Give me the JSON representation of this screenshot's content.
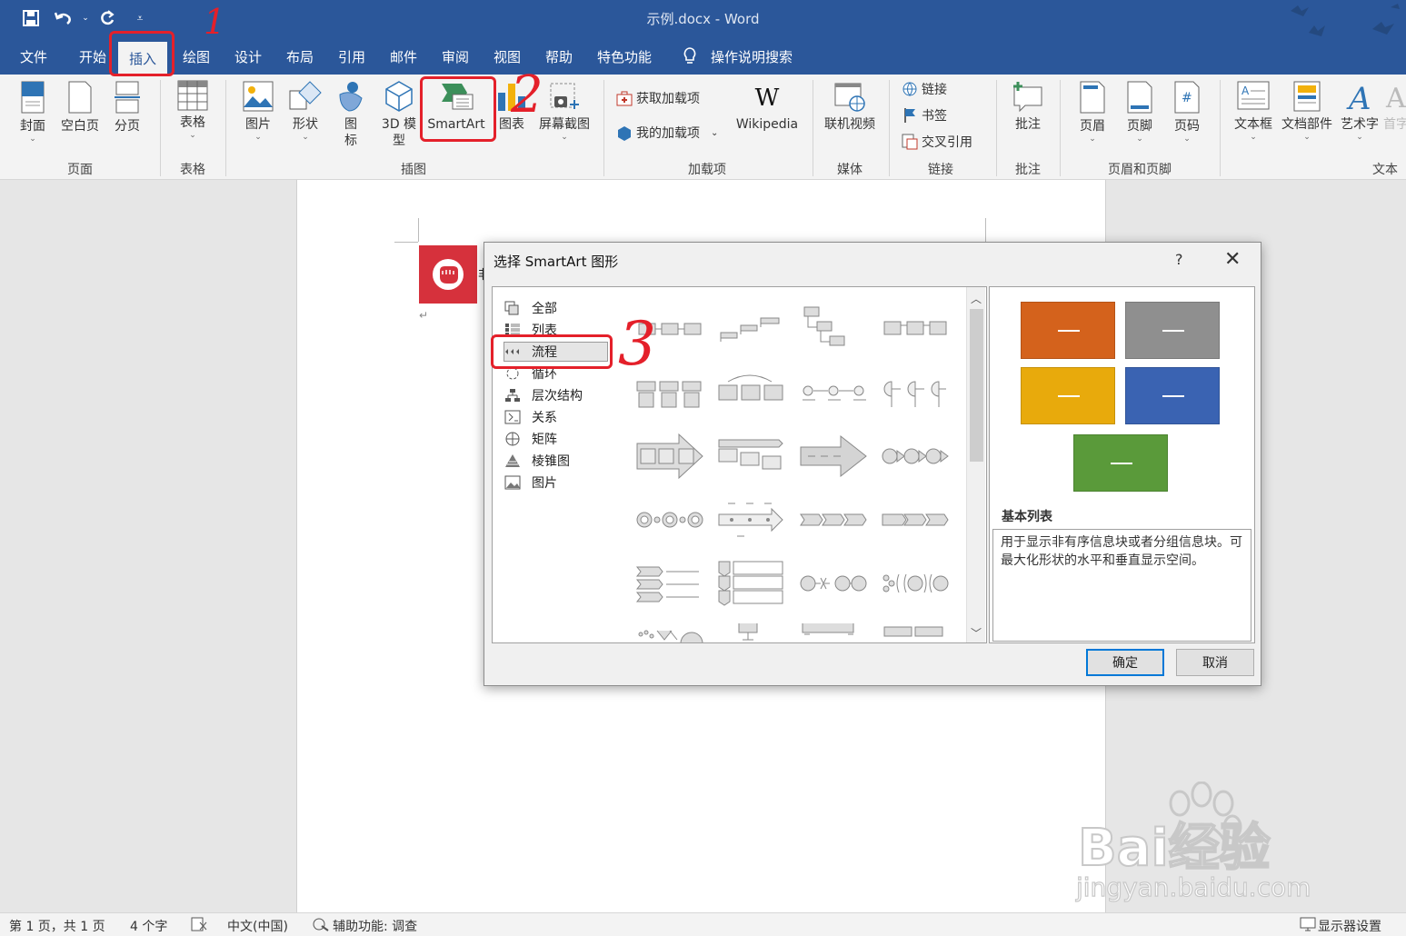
{
  "quick_access": {
    "save_icon": "save-icon",
    "undo_icon": "undo-icon",
    "redo_icon": "redo-icon",
    "customize_icon": "customize-icon"
  },
  "window": {
    "title": "示例.docx  -  Word"
  },
  "menu": {
    "tabs": [
      "文件",
      "开始",
      "插入",
      "绘图",
      "设计",
      "布局",
      "引用",
      "邮件",
      "审阅",
      "视图",
      "帮助",
      "特色功能"
    ],
    "active_tab": "插入",
    "tell_me": "操作说明搜索"
  },
  "ribbon": {
    "pages_group": {
      "label": "页面",
      "buttons": [
        "封面",
        "空白页",
        "分页"
      ]
    },
    "tables_group": {
      "label": "表格",
      "buttons": [
        "表格"
      ]
    },
    "illustrations_group": {
      "label": "插图",
      "buttons": [
        "图片",
        "形状",
        "图",
        "标",
        "3D 模",
        "型",
        "SmartArt",
        "图表",
        "屏幕截图"
      ]
    },
    "addins_group": {
      "label": "加载项",
      "get_addins": "获取加载项",
      "my_addins": "我的加载项",
      "wikipedia": "Wikipedia"
    },
    "media_group": {
      "label": "媒体",
      "online_video": "联机视频"
    },
    "links_group": {
      "label": "链接",
      "link": "链接",
      "bookmark": "书签",
      "cross_ref": "交叉引用"
    },
    "comments_group": {
      "label": "批注",
      "comment": "批注"
    },
    "header_footer_group": {
      "label": "页眉和页脚",
      "header": "页眉",
      "footer": "页脚",
      "page_number": "页码"
    },
    "text_group": {
      "label": "文本",
      "textbox": "文本框",
      "quick_parts": "文档部件",
      "wordart": "艺术字",
      "dropcap": "首字"
    }
  },
  "document": {
    "partial_text": "非",
    "para_mark": "↵"
  },
  "dialog": {
    "title": "选择 SmartArt 图形",
    "help": "?",
    "close": "✕",
    "categories": [
      "全部",
      "列表",
      "流程",
      "循环",
      "层次结构",
      "关系",
      "矩阵",
      "棱锥图",
      "图片"
    ],
    "selected_category": "流程",
    "preview_title": "基本列表",
    "preview_desc": "用于显示非有序信息块或者分组信息块。可最大化形状的水平和垂直显示空间。",
    "preview_colors": [
      "#d4621c",
      "#8f8f8f",
      "#e8aa0c",
      "#3a63b2",
      "#5a9a3a"
    ],
    "ok": "确定",
    "cancel": "取消"
  },
  "statusbar": {
    "page": "第 1 页，共 1 页",
    "words": "4 个字",
    "language": "中文(中国)",
    "accessibility": "辅助功能: 调查",
    "display": "显示器设置"
  },
  "annotations": {
    "step1": "1",
    "step2": "2",
    "step3": "3"
  },
  "watermark": {
    "brand": "Bai经验",
    "url": "jingyan.baidu.com"
  }
}
